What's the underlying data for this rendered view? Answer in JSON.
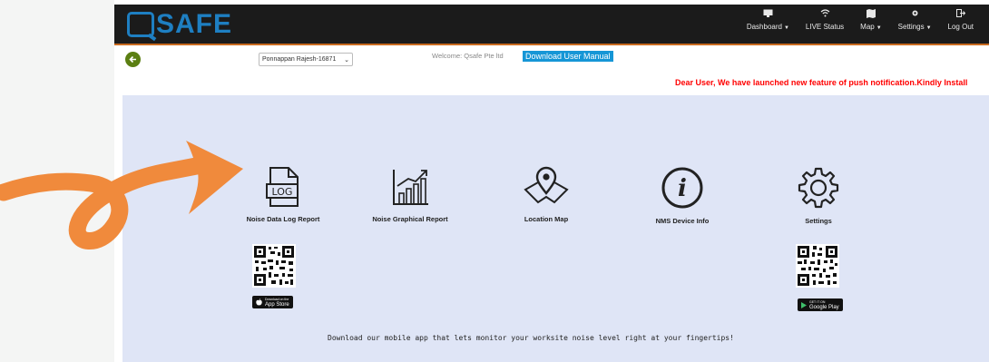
{
  "brand": {
    "logo_text": "SAFE"
  },
  "nav": [
    {
      "label": "Dashboard",
      "icon": "monitor-icon",
      "caret": true
    },
    {
      "label": "LIVE Status",
      "icon": "wifi-icon",
      "caret": false
    },
    {
      "label": "Map",
      "icon": "map-icon",
      "caret": true
    },
    {
      "label": "Settings",
      "icon": "gear-icon",
      "caret": true
    },
    {
      "label": "Log Out",
      "icon": "logout-icon",
      "caret": false
    }
  ],
  "user_select": {
    "value": "Ponnappan Rajesh-16871"
  },
  "welcome": "Welcome: Qsafe Pte ltd",
  "manual_button": "Download User Manual",
  "notice": "Dear User, We have launched new feature of push notification.Kindly Install",
  "tiles": [
    {
      "label": "Noise Data Log Report",
      "icon": "log-file-icon"
    },
    {
      "label": "Noise Graphical Report",
      "icon": "bar-chart-icon"
    },
    {
      "label": "Location Map",
      "icon": "map-pin-icon"
    },
    {
      "label": "NMS Device Info",
      "icon": "info-icon"
    },
    {
      "label": "Settings",
      "icon": "gear-icon"
    }
  ],
  "app_store": {
    "small": "Download on the",
    "big": "App Store"
  },
  "google_play": {
    "small": "GET IT ON",
    "big": "Google Play"
  },
  "tagline": "Download our mobile app that lets monitor your worksite noise level right at your fingertips!",
  "colors": {
    "topbar": "#1b1b1b",
    "brand_blue": "#1e7fc2",
    "panel": "#dfe5f6",
    "notice_red": "#ff0000",
    "manual_blue": "#1696d6",
    "back_green": "#5b7f12",
    "arrow_orange": "#f08a3c"
  }
}
